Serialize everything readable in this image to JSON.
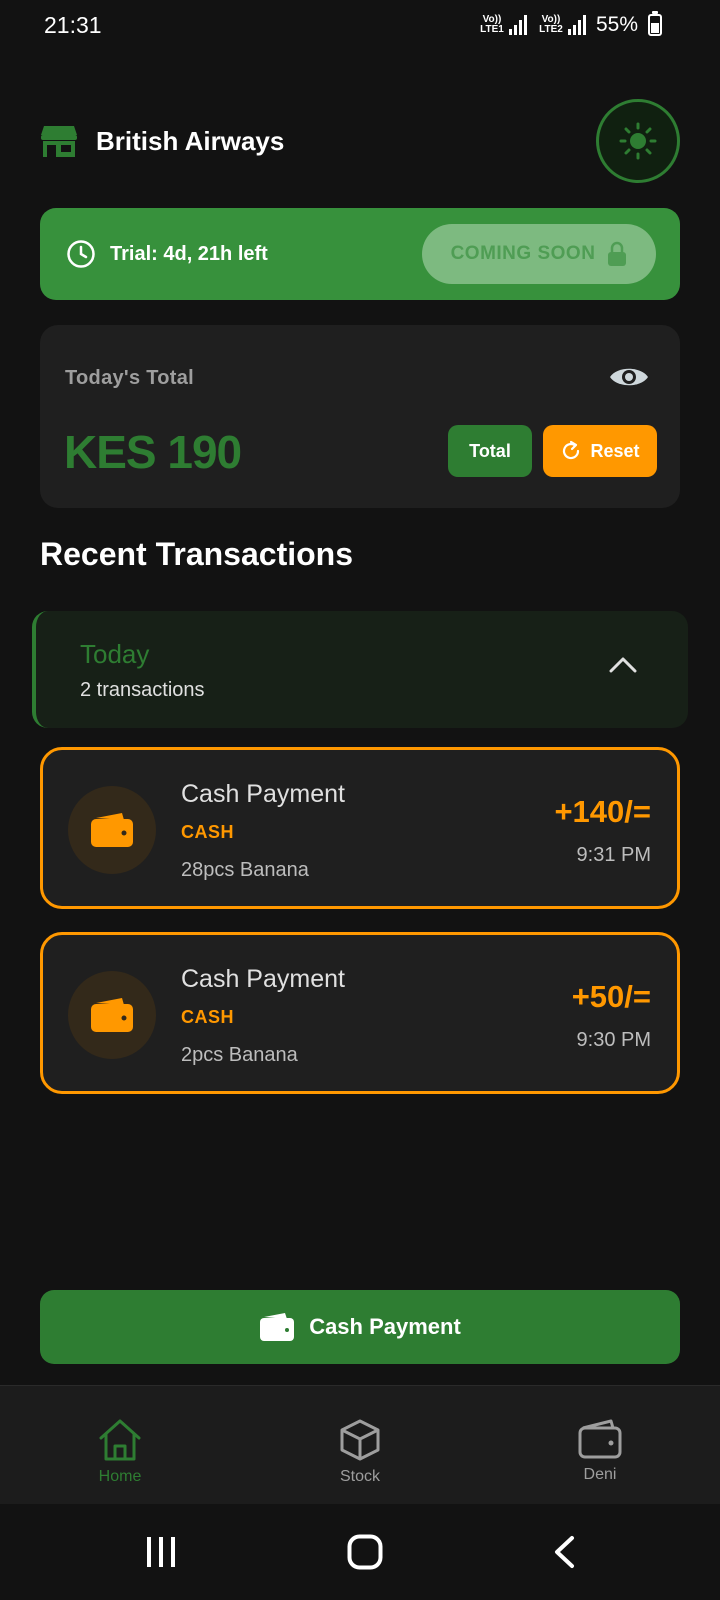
{
  "status_bar": {
    "time": "21:31",
    "sim1_label": "Vo)) LTE1",
    "sim2_label": "Vo)) LTE2",
    "battery": "55%"
  },
  "header": {
    "store_icon": "store-icon",
    "title": "British Airways",
    "theme_icon": "sun-icon"
  },
  "trial": {
    "icon": "clock-icon",
    "text": "Trial: 4d, 21h left",
    "coming_soon_label": "COMING SOON",
    "lock_icon": "lock-icon"
  },
  "totals": {
    "label": "Today's Total",
    "amount": "KES 190",
    "total_button": "Total",
    "reset_button": "Reset"
  },
  "recent": {
    "title": "Recent Transactions",
    "group": {
      "title": "Today",
      "count": "2 transactions"
    },
    "transactions": [
      {
        "title": "Cash Payment",
        "method": "CASH",
        "description": "28pcs Banana",
        "amount": "+140/=",
        "time": "9:31 PM"
      },
      {
        "title": "Cash Payment",
        "method": "CASH",
        "description": "2pcs Banana",
        "amount": "+50/=",
        "time": "9:30 PM"
      }
    ]
  },
  "cash_button": {
    "label": "Cash Payment"
  },
  "bottom_nav": [
    {
      "label": "Home",
      "icon": "home-icon",
      "active": true
    },
    {
      "label": "Stock",
      "icon": "cube-icon",
      "active": false
    },
    {
      "label": "Deni",
      "icon": "wallet-icon",
      "active": false
    }
  ],
  "colors": {
    "background": "#121212",
    "card": "#1f1f1f",
    "green": "#2e7d32",
    "banner_green": "#37913c",
    "orange": "#ff9800"
  }
}
